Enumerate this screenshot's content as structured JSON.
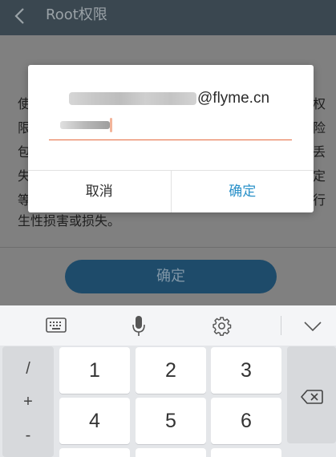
{
  "appbar": {
    "title": "Root权限"
  },
  "content": {
    "line_chars": [
      "使",
      "限",
      "包",
      "失",
      "等",
      "生性损害或损失。"
    ],
    "right_chars": [
      "权",
      "险",
      "丢",
      "定",
      "行"
    ],
    "confirm_label": "确定"
  },
  "dialog": {
    "email_domain": "@flyme.cn",
    "cancel_label": "取消",
    "confirm_label": "确定",
    "accent_color": "#2a91c9",
    "underline_color": "#e66a3e"
  },
  "keyboard": {
    "numbers": [
      "1",
      "2",
      "3",
      "4",
      "5",
      "6"
    ],
    "symbols": [
      "/",
      "+",
      "-"
    ]
  }
}
